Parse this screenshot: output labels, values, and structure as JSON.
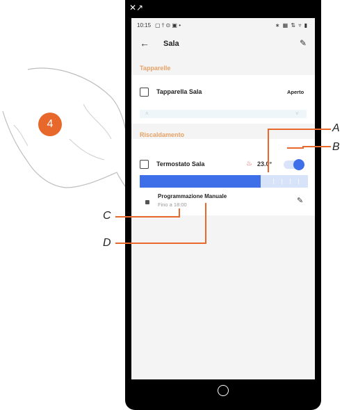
{
  "status": {
    "time": "10:15",
    "left_icons": "▢ ⫯ ⊙ ▣ •",
    "right_icons": "∗ ▦ ⇅ ▿ ▮"
  },
  "header": {
    "back_icon": "←",
    "title": "Sala",
    "edit_icon": "✎"
  },
  "sections": {
    "blinds": {
      "title": "Tapparelle",
      "item": {
        "label": "Tapparella Sala",
        "status": "Aperto",
        "up_icon": "˄",
        "down_icon": "˅"
      }
    },
    "heating": {
      "title": "Riscaldamento",
      "item": {
        "label": "Termostato Sala",
        "flame_icon": "♨",
        "temperature": "23.0°",
        "toggle_on": true,
        "setpoint_fraction": 0.72,
        "program_title": "Programmazione Manuale",
        "program_subtitle": "Fino a 18:00"
      }
    }
  },
  "step_badge": "4",
  "callouts": {
    "a": "A",
    "b": "B",
    "c": "C",
    "d": "D"
  },
  "colors": {
    "accent": "#e8672b",
    "section": "#e8a165",
    "blue": "#3f6fe8",
    "callout_line": "#e8672b"
  }
}
